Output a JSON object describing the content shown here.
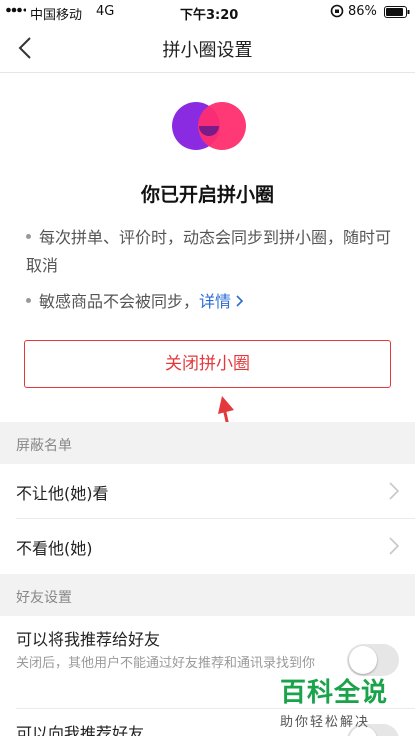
{
  "status_bar": {
    "carrier": "中国移动",
    "network": "4G",
    "time": "下午3:20",
    "battery": "86%"
  },
  "nav": {
    "title": "拼小圈设置",
    "back_icon": "chevron-left-icon"
  },
  "hero": {
    "title": "你已开启拼小圈",
    "logo_colors": [
      "#8a2be2",
      "#ff2d6f"
    ]
  },
  "bullets": [
    {
      "text": "每次拼单、评价时，动态会同步到拼小圈，随时可取消"
    },
    {
      "text": "敏感商品不会被同步，",
      "link": "详情"
    }
  ],
  "close_button": {
    "label": "关闭拼小圈",
    "color": "#e4393c"
  },
  "block_section": {
    "header": "屏蔽名单",
    "items": [
      {
        "label": "不让他(她)看"
      },
      {
        "label": "不看他(她)"
      }
    ]
  },
  "friend_section": {
    "header": "好友设置",
    "items": [
      {
        "label": "可以将我推荐给好友",
        "sub": "关闭后，其他用户不能通过好友推荐和通讯录找到你",
        "enabled": false
      },
      {
        "label": "可以向我推荐好友",
        "enabled": false
      }
    ]
  },
  "watermark": {
    "title": "百科全说",
    "subtitle": "助你轻松解决"
  }
}
